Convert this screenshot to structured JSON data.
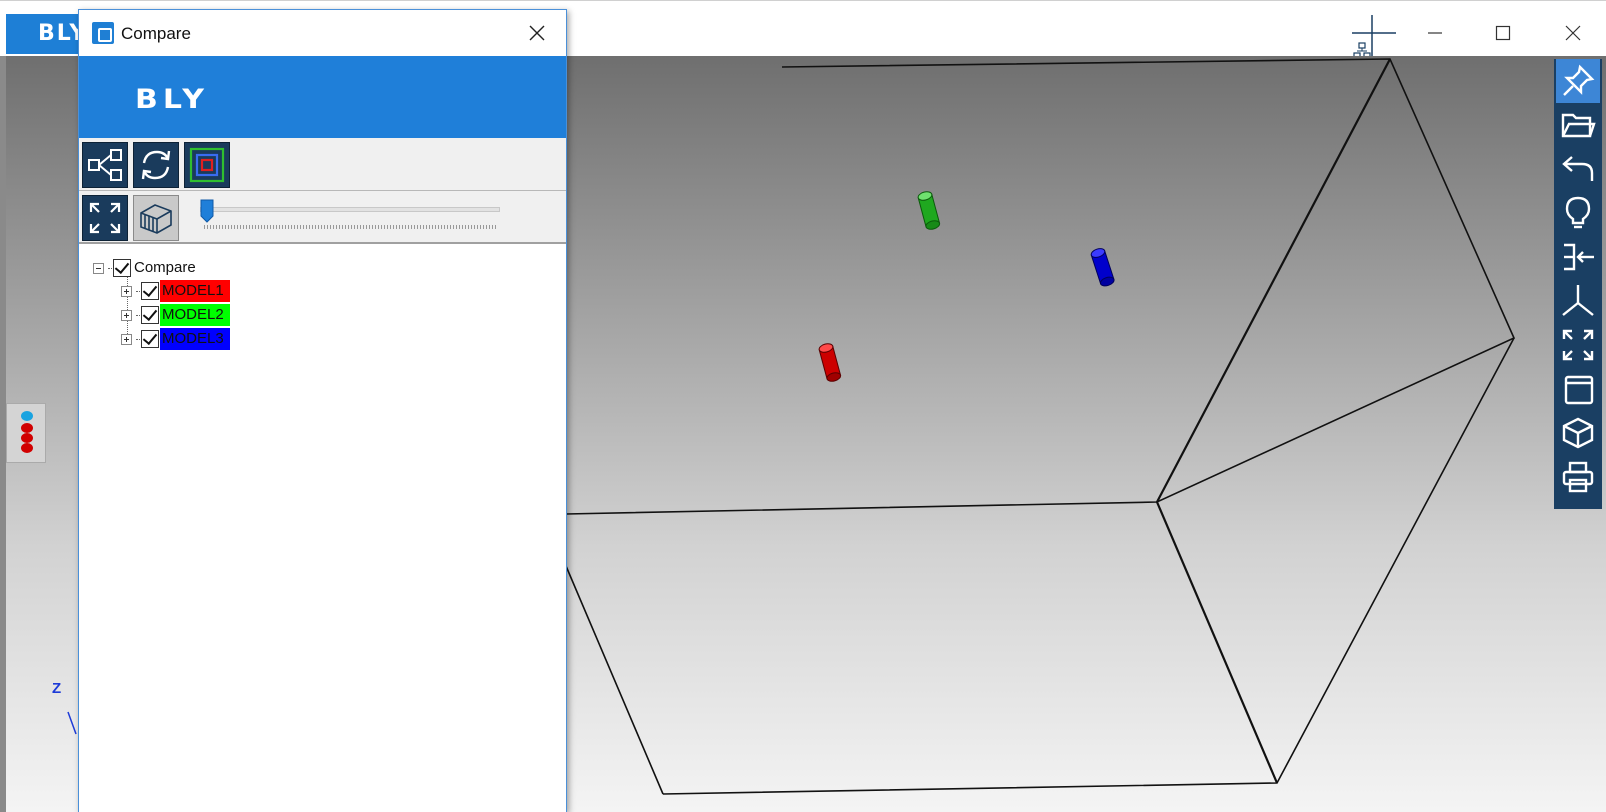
{
  "app": {
    "brand": "BLY"
  },
  "window": {
    "minimize_icon": "minimize-icon",
    "maximize_icon": "maximize-icon",
    "close_icon": "close-icon"
  },
  "viewport": {
    "axis_label": "Z",
    "models": [
      {
        "name": "MODEL1",
        "color": "#cc0000"
      },
      {
        "name": "MODEL2",
        "color": "#1fa81f"
      },
      {
        "name": "MODEL3",
        "color": "#0000cc"
      }
    ]
  },
  "right_toolbar": {
    "items": [
      "pin-icon",
      "open-folder-icon",
      "undo-icon",
      "lightbulb-icon",
      "import-icon",
      "axes-icon",
      "fit-view-icon",
      "window-icon",
      "view-cube-icon",
      "print-icon"
    ],
    "background": "#1a3f63",
    "active_color": "#3d86d6"
  },
  "dialog": {
    "title": "Compare",
    "banner_logo": "BLY",
    "banner_color": "#1f7fd9",
    "toolbar1": [
      "hierarchy-icon",
      "refresh-icon",
      "layers-frame-icon"
    ],
    "toolbar2": [
      "fit-all-icon",
      "box-section-icon"
    ],
    "slider": {
      "value": 0
    },
    "tree": {
      "root": {
        "label": "Compare",
        "checked": true,
        "expanded": true
      },
      "children": [
        {
          "label": "MODEL1",
          "checked": true,
          "expanded": false,
          "bg": "#ff0000"
        },
        {
          "label": "MODEL2",
          "checked": true,
          "expanded": false,
          "bg": "#00ff00"
        },
        {
          "label": "MODEL3",
          "checked": true,
          "expanded": false,
          "bg": "#0000ff"
        }
      ]
    }
  }
}
